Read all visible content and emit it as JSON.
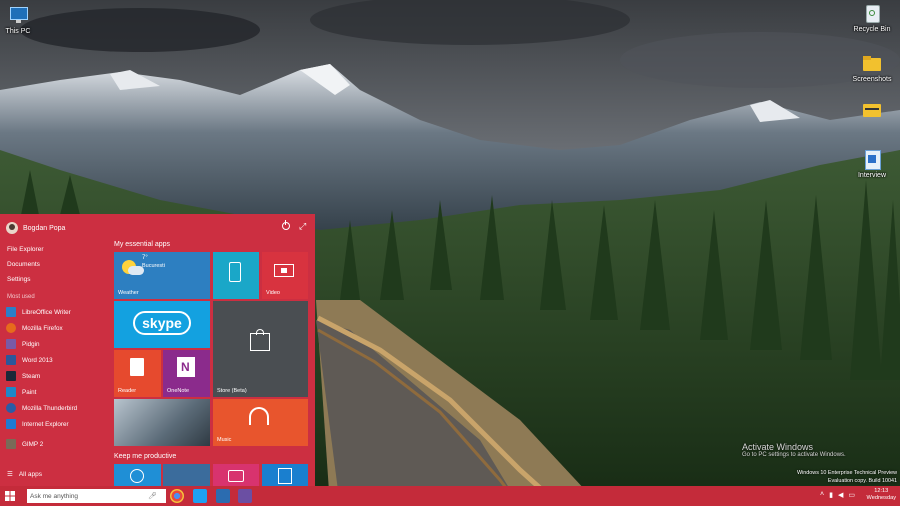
{
  "desktop": {
    "icons": [
      {
        "label": "This PC",
        "icon": "monitor-icon"
      },
      {
        "label": "Recycle Bin",
        "icon": "recycle-bin-icon"
      },
      {
        "label": "Screenshots",
        "icon": "folder-icon"
      },
      {
        "label": "",
        "icon": "folder-icon"
      },
      {
        "label": "Interview",
        "icon": "document-icon"
      }
    ]
  },
  "start_menu": {
    "user_name": "Bogdan Popa",
    "places": [
      "File Explorer",
      "Documents",
      "Settings"
    ],
    "most_used_label": "Most used",
    "most_used": [
      {
        "label": "LibreOffice Writer",
        "color": "#2a7fc9"
      },
      {
        "label": "Mozilla Firefox",
        "color": "#e66b1c"
      },
      {
        "label": "Pidgin",
        "color": "#7a5aa6"
      },
      {
        "label": "Word 2013",
        "color": "#2b579a"
      },
      {
        "label": "Steam",
        "color": "#1b2838"
      },
      {
        "label": "Paint",
        "color": "#1e88c9"
      },
      {
        "label": "Mozilla Thunderbird",
        "color": "#2a5ca6"
      },
      {
        "label": "Internet Explorer",
        "color": "#1f7ad1"
      },
      {
        "label": "GIMP 2",
        "color": "#7a6a58"
      }
    ],
    "all_apps_label": "All apps",
    "group1_title": "My essential apps",
    "group2_title": "Keep me productive",
    "tiles": {
      "weather": {
        "label": "Weather",
        "temp": "7°",
        "city": "Bucuresti"
      },
      "phone": {
        "label": ""
      },
      "video": {
        "label": "Video"
      },
      "skype": {
        "label": "skype"
      },
      "store": {
        "label": "Store (Beta)"
      },
      "reader": {
        "label": "Reader"
      },
      "onenote": {
        "label": "OneNote"
      },
      "photos": {
        "label": ""
      },
      "music": {
        "label": "Music"
      }
    }
  },
  "taskbar": {
    "search_placeholder": "Ask me anything",
    "apps": [
      "chrome-icon",
      "twitter-icon",
      "store-icon",
      "media-icon"
    ]
  },
  "watermark": {
    "title": "Activate Windows",
    "subtitle": "Go to PC settings to activate Windows."
  },
  "build_info": {
    "line1": "Windows 10 Enterprise Technical Preview",
    "line2": "Evaluation copy. Build 10041"
  },
  "clock": {
    "time": "12:13",
    "day": "Wednesday"
  },
  "colors": {
    "accent": "#cc2f41",
    "taskbar": "#c42b3a"
  }
}
